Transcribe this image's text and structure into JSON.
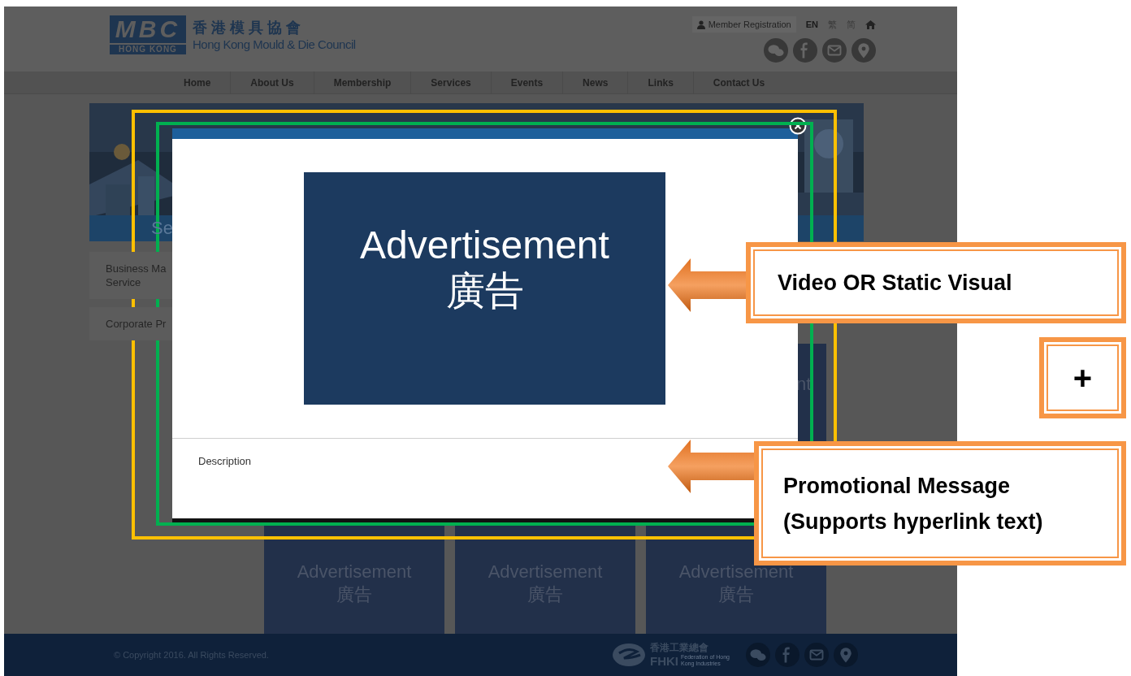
{
  "header": {
    "logo_mark": "MBC",
    "logo_sub": "HONG KONG",
    "name_zh": "香 港 模 具 協 會",
    "name_en": "Hong Kong Mould & Die Council",
    "member_link": "Member Registration",
    "languages": [
      {
        "label": "EN",
        "selected": true
      },
      {
        "label": "繁",
        "selected": false
      },
      {
        "label": "简",
        "selected": false
      }
    ]
  },
  "nav": [
    "Home",
    "About Us",
    "Membership",
    "Services",
    "Events",
    "News",
    "Links",
    "Contact Us"
  ],
  "banner": {
    "heading": "Se"
  },
  "sidebar": {
    "items": [
      {
        "lines": [
          "Business Ma",
          "Service"
        ]
      },
      {
        "lines": [
          "Corporate Pr"
        ]
      }
    ]
  },
  "side_tile": {
    "text": "nt"
  },
  "ad_tiles": [
    {
      "title": "Advertisement",
      "title_zh": "廣告"
    },
    {
      "title": "Advertisement",
      "title_zh": "廣告"
    },
    {
      "title": "Advertisement",
      "title_zh": "廣告"
    }
  ],
  "footer": {
    "copyright": "© Copyright 2016. All Rights Reserved.",
    "partner_zh": "香港工業總會",
    "partner_en": "FHKI",
    "partner_caption": "Federation of Hong Kong Industries"
  },
  "modal": {
    "ad_title": "Advertisement",
    "ad_title_zh": "廣告",
    "description": "Description"
  },
  "annotations": [
    {
      "lines": [
        "Video OR Static Visual"
      ]
    },
    {
      "lines": [
        "Promotional Message",
        "(Supports hyperlink text)"
      ]
    }
  ],
  "add_button": "+"
}
